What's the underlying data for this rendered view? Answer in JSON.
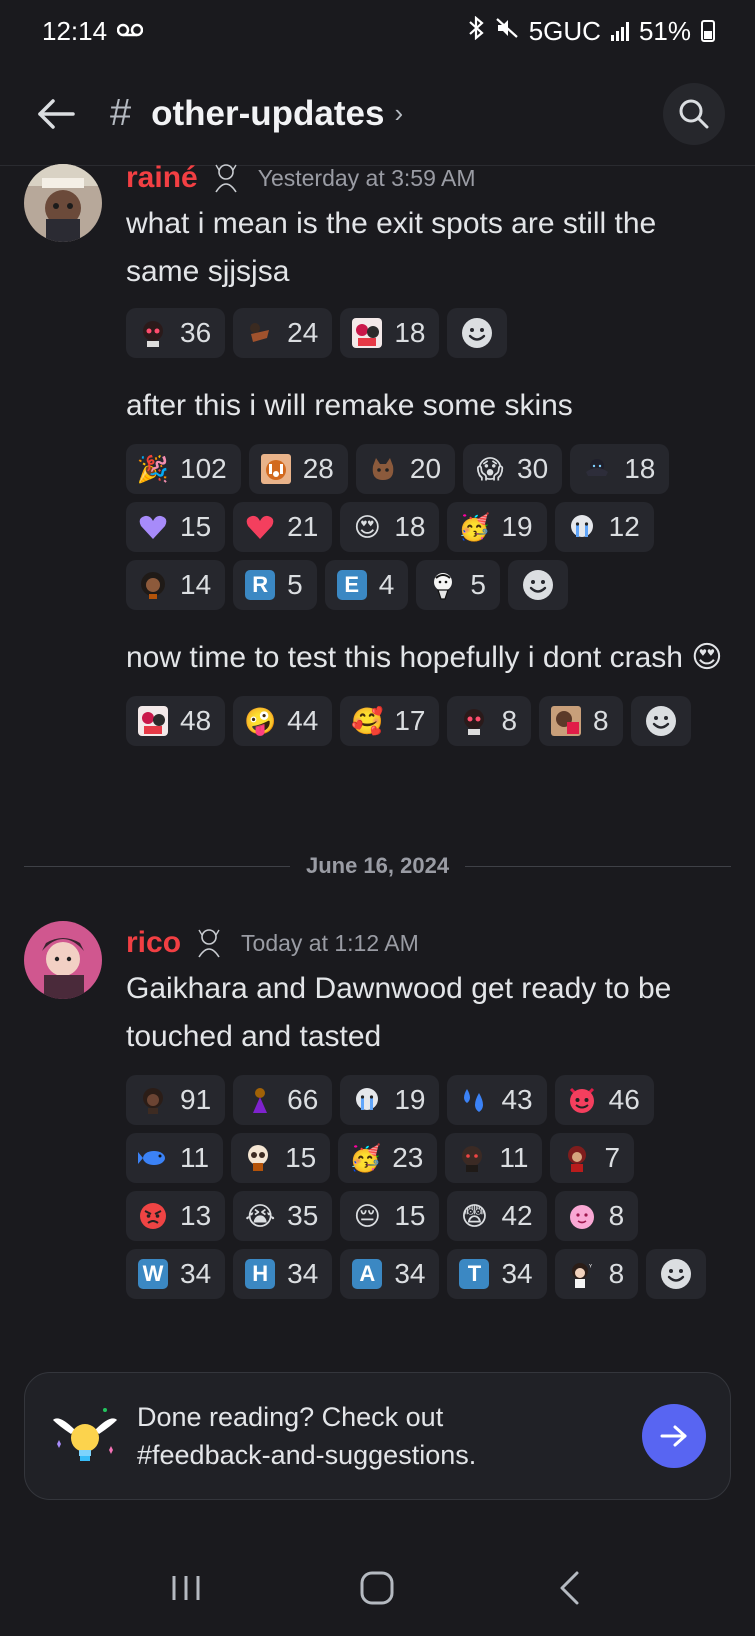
{
  "status_bar": {
    "time": "12:14",
    "voicemail_icon": "voicemail-icon",
    "network": "5GUC",
    "battery": "51%"
  },
  "header": {
    "hash": "#",
    "channel_name": "other-updates",
    "chevron": "›"
  },
  "messages": [
    {
      "username": "rainé",
      "timestamp": "Yesterday at 3:59 AM",
      "blocks": [
        {
          "text": "what i mean is the exit spots are still the same sjjsjsa",
          "reactions": [
            {
              "icon": "custom-avatar-emoji",
              "count": "36"
            },
            {
              "icon": "custom-figure-emoji",
              "count": "24"
            },
            {
              "icon": "custom-character-emoji",
              "count": "18"
            }
          ]
        },
        {
          "text": "after this i will remake some skins",
          "reactions": [
            {
              "icon": "party-popper-emoji",
              "count": "102"
            },
            {
              "icon": "custom-tiger-emoji",
              "count": "28"
            },
            {
              "icon": "custom-cat-emoji",
              "count": "20"
            },
            {
              "icon": "screaming-face-emoji",
              "count": "30"
            },
            {
              "icon": "custom-dark-figure-emoji",
              "count": "18"
            },
            {
              "icon": "purple-heart-emoji",
              "count": "15"
            },
            {
              "icon": "heart-emoji",
              "count": "21"
            },
            {
              "icon": "heart-eyes-emoji",
              "count": "18"
            },
            {
              "icon": "partying-face-emoji",
              "count": "19"
            },
            {
              "icon": "custom-crying-emoji",
              "count": "12"
            },
            {
              "icon": "custom-girl-emoji",
              "count": "14"
            },
            {
              "icon": "regional-r-emoji",
              "label": "R",
              "count": "5"
            },
            {
              "icon": "regional-e-emoji",
              "label": "E",
              "count": "4"
            },
            {
              "icon": "custom-sketch-emoji",
              "count": "5"
            }
          ]
        },
        {
          "text": "now time to test this hopefully i dont crash 😍",
          "reactions": [
            {
              "icon": "custom-character-emoji",
              "count": "48"
            },
            {
              "icon": "zany-face-emoji",
              "count": "44"
            },
            {
              "icon": "smiling-hearts-emoji",
              "count": "17"
            },
            {
              "icon": "custom-avatar-emoji",
              "count": "8"
            },
            {
              "icon": "custom-portrait-emoji",
              "count": "8"
            }
          ]
        }
      ]
    },
    {
      "username": "rico",
      "timestamp": "Today at 1:12 AM",
      "blocks": [
        {
          "text": "Gaikhara and Dawnwood get ready to be touched and tasted",
          "reactions": [
            {
              "icon": "custom-dark-face-emoji",
              "count": "91"
            },
            {
              "icon": "custom-purple-figure-emoji",
              "count": "66"
            },
            {
              "icon": "custom-crying-emoji",
              "count": "19"
            },
            {
              "icon": "sweat-droplets-emoji",
              "count": "43"
            },
            {
              "icon": "smiling-devil-emoji",
              "count": "46"
            },
            {
              "icon": "fish-emoji",
              "count": "11"
            },
            {
              "icon": "custom-skull-emoji",
              "count": "15"
            },
            {
              "icon": "partying-face-emoji",
              "count": "23"
            },
            {
              "icon": "custom-shadow-emoji",
              "count": "11"
            },
            {
              "icon": "custom-red-figure-emoji",
              "count": "7"
            },
            {
              "icon": "angry-face-emoji",
              "count": "13"
            },
            {
              "icon": "loudly-crying-emoji",
              "count": "35"
            },
            {
              "icon": "relieved-face-emoji",
              "count": "15"
            },
            {
              "icon": "anxious-face-emoji",
              "count": "42"
            },
            {
              "icon": "custom-pink-blob-emoji",
              "count": "8"
            },
            {
              "icon": "regional-w-emoji",
              "label": "W",
              "count": "34"
            },
            {
              "icon": "regional-h-emoji",
              "label": "H",
              "count": "34"
            },
            {
              "icon": "regional-a-emoji",
              "label": "A",
              "count": "34"
            },
            {
              "icon": "regional-t-emoji",
              "label": "T",
              "count": "34"
            },
            {
              "icon": "custom-boy-emoji",
              "count": "8"
            }
          ]
        }
      ]
    }
  ],
  "date_divider": "June 16, 2024",
  "done_banner": {
    "line1": "Done reading? Check out",
    "line2": "#feedback-and-suggestions."
  },
  "colors": {
    "background": "#1a1a1e",
    "username": "#f23f43",
    "accent": "#5865f2",
    "reaction_bg": "#26272d"
  }
}
